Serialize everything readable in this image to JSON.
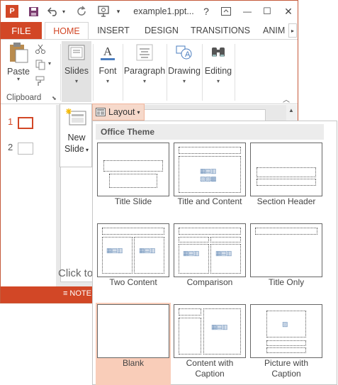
{
  "titlebar": {
    "app_icon": "P",
    "filename": "example1.ppt...",
    "help": "?",
    "minimize": "—",
    "maximize": "☐",
    "close": "✕"
  },
  "tabs": {
    "file": "FILE",
    "items": [
      "HOME",
      "INSERT",
      "DESIGN",
      "TRANSITIONS",
      "ANIM"
    ],
    "active_index": 0
  },
  "ribbon": {
    "paste": "Paste",
    "clipboard": "Clipboard",
    "slides": "Slides",
    "font": "Font",
    "paragraph": "Paragraph",
    "drawing": "Drawing",
    "editing": "Editing"
  },
  "slides_pane": {
    "items": [
      "1",
      "2"
    ],
    "selected_index": 0
  },
  "slide": {
    "placeholder": "Click to"
  },
  "status": {
    "notes": "NOTE"
  },
  "new_slide": {
    "line1": "New",
    "line2": "Slide"
  },
  "layout_button": {
    "label": "Layout"
  },
  "gallery": {
    "heading": "Office Theme",
    "layouts": [
      {
        "name": "Title Slide"
      },
      {
        "name": "Title and Content"
      },
      {
        "name": "Section Header"
      },
      {
        "name": "Two Content"
      },
      {
        "name": "Comparison"
      },
      {
        "name": "Title Only"
      },
      {
        "name": "Blank",
        "selected": true
      },
      {
        "name": "Content with Caption"
      },
      {
        "name": "Picture with Caption"
      }
    ]
  },
  "colors": {
    "accent": "#d24726",
    "selected": "#f9cdb9"
  }
}
